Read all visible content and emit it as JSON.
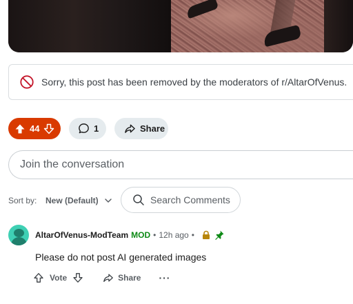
{
  "removed_notice": {
    "text": "Sorry, this post has been removed by the moderators of r/AltarOfVenus."
  },
  "actions": {
    "vote_count": "44",
    "comment_count": "1",
    "share_label": "Share"
  },
  "join": {
    "placeholder": "Join the conversation"
  },
  "sort": {
    "label": "Sort by:",
    "value": "New (Default)"
  },
  "search": {
    "placeholder": "Search Comments"
  },
  "comment": {
    "author": "AltarOfVenus-ModTeam",
    "badge": "MOD",
    "separator": "•",
    "time": "12h ago",
    "separator2": "•",
    "body": "Please do not post AI generated images",
    "vote_label": "Vote",
    "share_label": "Share",
    "more_label": "···"
  },
  "colors": {
    "upvote_accent": "#d93a00",
    "mod_green": "#0e8a16",
    "avatar_teal": "#3fd0b4",
    "lock_gold": "#b8860b"
  },
  "icons": [
    "ban-icon",
    "upvote-icon",
    "downvote-icon",
    "comment-icon",
    "share-icon",
    "chevron-down-icon",
    "search-icon",
    "lock-icon",
    "pin-icon",
    "more-icon"
  ]
}
